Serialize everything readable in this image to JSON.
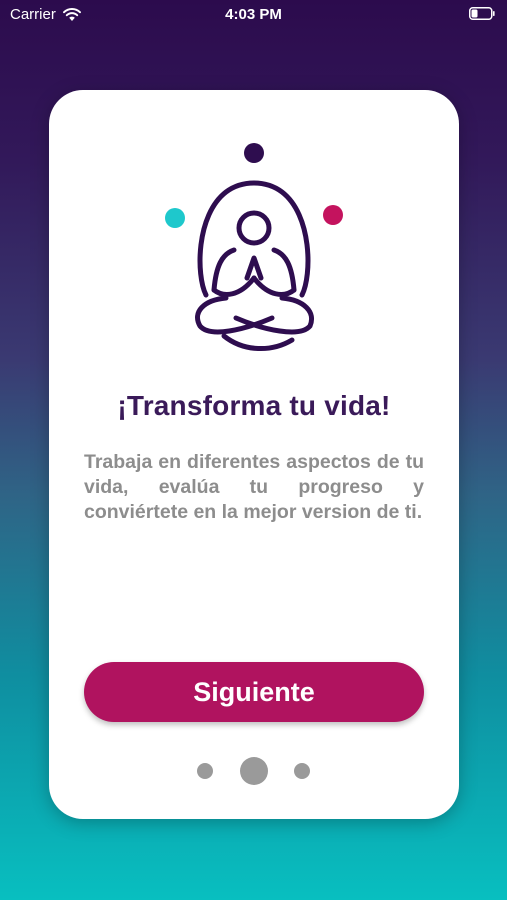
{
  "status_bar": {
    "carrier": "Carrier",
    "time": "4:03 PM",
    "wifi_icon": "wifi-icon",
    "battery_icon": "battery-icon"
  },
  "onboarding": {
    "illustration_icon": "meditation-person-icon",
    "title": "¡Transforma tu vida!",
    "description": "Trabaja en diferentes aspectos de tu vida, evalúa tu progreso y conviértete en la mejor version de ti.",
    "next_button_label": "Siguiente",
    "pagination": {
      "total_pages": 3,
      "current_page": 2
    }
  },
  "colors": {
    "gradient_top": "#2c0b4d",
    "gradient_bottom": "#08bfc0",
    "title": "#3a1a59",
    "button": "#b0135f",
    "accent_cyan": "#1ec8cc",
    "accent_magenta": "#c4135e",
    "description_text": "#8d8d8d",
    "dot": "#9a9a9a"
  }
}
